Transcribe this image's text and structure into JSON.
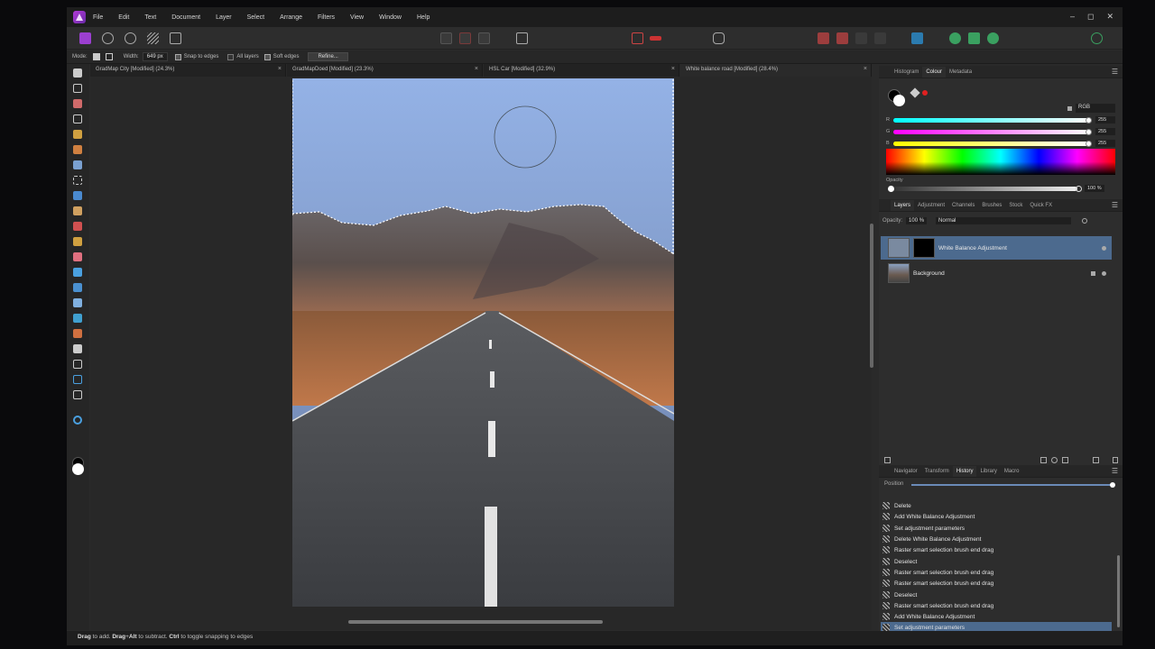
{
  "menubar": {
    "items": [
      "File",
      "Edit",
      "Text",
      "Document",
      "Layer",
      "Select",
      "Arrange",
      "Filters",
      "View",
      "Window",
      "Help"
    ],
    "window_controls": [
      "–",
      "◻",
      "✕"
    ]
  },
  "context_toolbar": {
    "mode_label": "Mode:",
    "width_label": "Width:",
    "width_value": "649 px",
    "snap_to_edges": "Snap to edges",
    "all_layers": "All layers",
    "soft_edges": "Soft edges",
    "refine_label": "Refine..."
  },
  "tabs": [
    {
      "label": "GradMap City [Modified] (24.3%)"
    },
    {
      "label": "GradMapDoed [Modified] (23.3%)"
    },
    {
      "label": "HSL Car [Modified] (32.9%)"
    },
    {
      "label": "White balance road [Modified] (28.4%)"
    }
  ],
  "tab_close": "×",
  "colour_panel": {
    "tabs": [
      "Histogram",
      "Colour",
      "Metadata"
    ],
    "active_tab": "Colour",
    "model": "RGB",
    "r_label": "R",
    "r_value": "255",
    "g_label": "G",
    "g_value": "255",
    "b_label": "B",
    "b_value": "255",
    "opacity_label": "Opacity",
    "opacity_value": "100 %"
  },
  "layers_panel": {
    "tabs": [
      "Layers",
      "Adjustment",
      "Channels",
      "Brushes",
      "Stock",
      "Quick FX"
    ],
    "active_tab": "Layers",
    "opacity_label": "Opacity:",
    "opacity_value": "100 %",
    "blend_mode": "Normal",
    "layers": [
      {
        "name": "White Balance Adjustment",
        "selected": true
      },
      {
        "name": "Background",
        "selected": false
      }
    ]
  },
  "history_panel": {
    "tabs": [
      "Navigator",
      "Transform",
      "History",
      "Library",
      "Macro"
    ],
    "active_tab": "History",
    "position_label": "Position",
    "items": [
      "Delete",
      "Add White Balance Adjustment",
      "Set adjustment parameters",
      "Delete White Balance Adjustment",
      "Raster smart selection brush end drag",
      "Deselect",
      "Raster smart selection brush end drag",
      "Raster smart selection brush end drag",
      "Deselect",
      "Raster smart selection brush end drag",
      "Add White Balance Adjustment",
      "Set adjustment parameters"
    ],
    "selected_index": 11
  },
  "status": {
    "drag": "Drag",
    "t1": " to add. ",
    "dragalt": "Drag",
    "t2": "+",
    "alt": "Alt",
    "t3": " to subtract. ",
    "ctrl": "Ctrl",
    "t4": " to toggle snapping to edges"
  },
  "colors": {
    "app_bg": "#2a2a2a",
    "selection": "#4c6a8e",
    "accent_purple": "#9b3fd0"
  }
}
